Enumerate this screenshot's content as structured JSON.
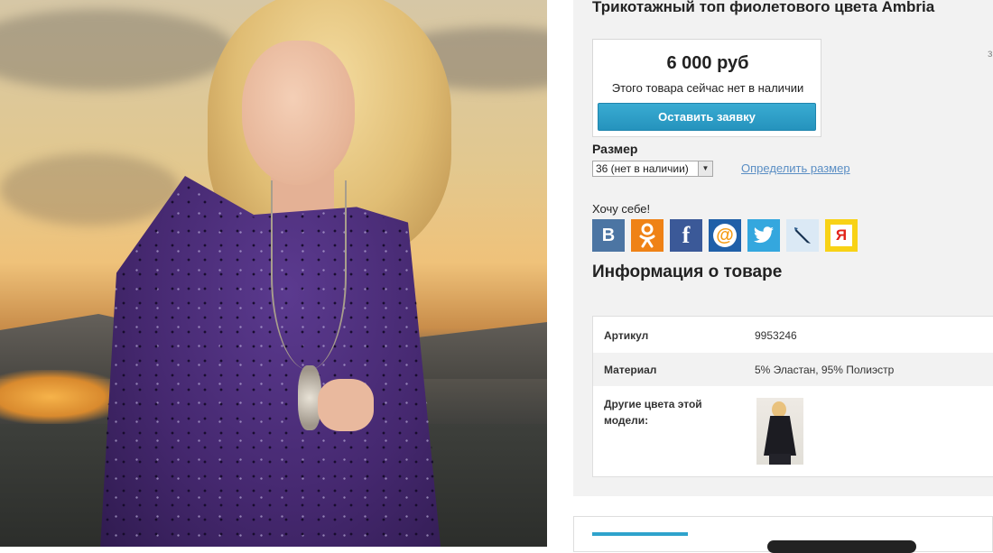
{
  "product": {
    "title": "Трикотажный топ фиолетового цвета Ambria",
    "price": "6 000 руб",
    "availability": "Этого товара сейчас нет в наличии",
    "order_button": "Оставить заявку"
  },
  "size": {
    "label": "Размер",
    "selected": "36 (нет в наличии)",
    "link": "Определить размер"
  },
  "share": {
    "label": "Хочу себе!",
    "buttons": [
      {
        "name": "vk",
        "glyph": "В",
        "color": "#4c75a3"
      },
      {
        "name": "odnoklassniki",
        "glyph": "ок",
        "color": "#ef8216"
      },
      {
        "name": "facebook",
        "glyph": "f",
        "color": "#3b5998"
      },
      {
        "name": "mailru",
        "glyph": "@",
        "color": "#1f5fa8"
      },
      {
        "name": "twitter",
        "glyph": "t",
        "color": "#34a7de"
      },
      {
        "name": "livejournal",
        "glyph": "✎",
        "color": "#dbe9f5"
      },
      {
        "name": "yandex",
        "glyph": "Я",
        "color": "#f8d216"
      }
    ]
  },
  "info": {
    "heading": "Информация о товаре",
    "rows": [
      {
        "key": "Артикул",
        "value": "9953246"
      },
      {
        "key": "Материал",
        "value": "5% Эластан, 95% Полиэстр"
      },
      {
        "key": "Другие цвета этой модели:",
        "value": ""
      }
    ]
  },
  "edge_mark": "з"
}
